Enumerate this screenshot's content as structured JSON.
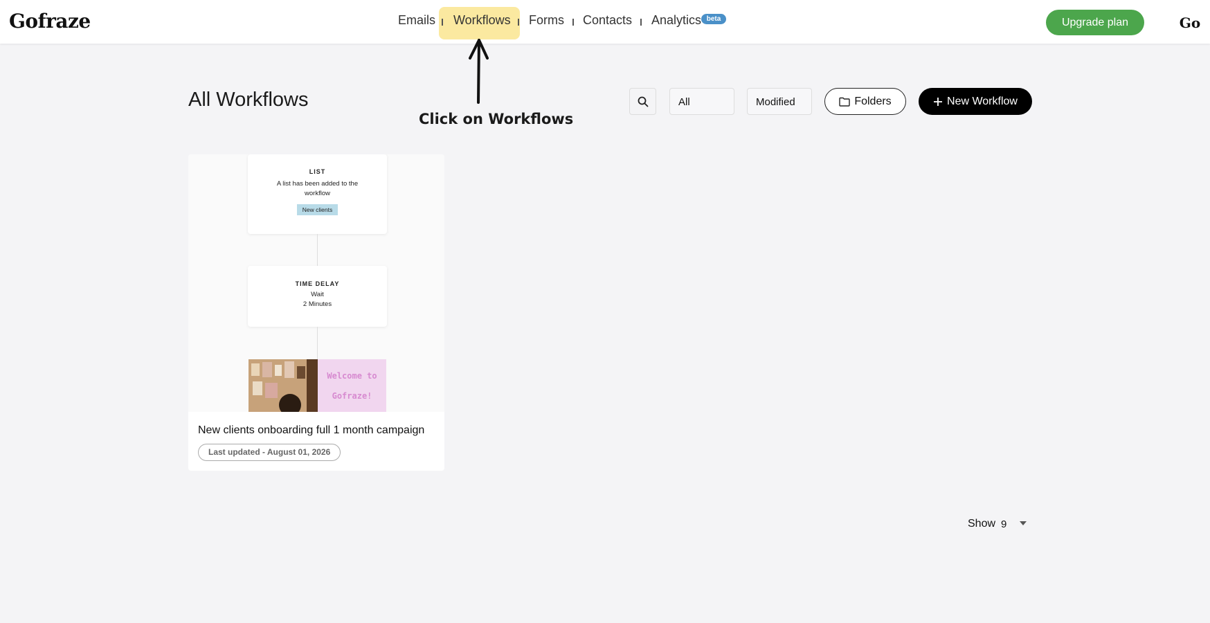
{
  "app": {
    "logo": "Gofraze",
    "avatar": "Go"
  },
  "nav": {
    "items": [
      "Emails",
      "Workflows",
      "Forms",
      "Contacts",
      "Analytics"
    ],
    "beta_badge": "beta",
    "active": "Workflows",
    "highlight_color": "#fbe9a0"
  },
  "header": {
    "upgrade_label": "Upgrade plan",
    "upgrade_color": "#4ca64c"
  },
  "annotation": {
    "text": "Click on Workflows"
  },
  "toolbar": {
    "title": "All Workflows",
    "filter_value": "All",
    "sort_value": "Modified",
    "folders_label": "Folders",
    "new_label": "New Workflow",
    "icons": [
      "search-icon",
      "folder-icon",
      "plus-icon"
    ]
  },
  "workflows": [
    {
      "title": "New clients onboarding full 1 month campaign",
      "updated": "Last updated - August 01, 2026",
      "preview": {
        "list_node": {
          "label": "LIST",
          "text": "A list has been added to the workflow",
          "chip": "New clients"
        },
        "delay_node": {
          "label": "TIME DELAY",
          "line1": "Wait",
          "line2": "2 Minutes"
        },
        "email_text_1": "Welcome to",
        "email_text_2": "Gofraze!"
      }
    }
  ],
  "pager": {
    "label": "Show",
    "value": "9"
  }
}
